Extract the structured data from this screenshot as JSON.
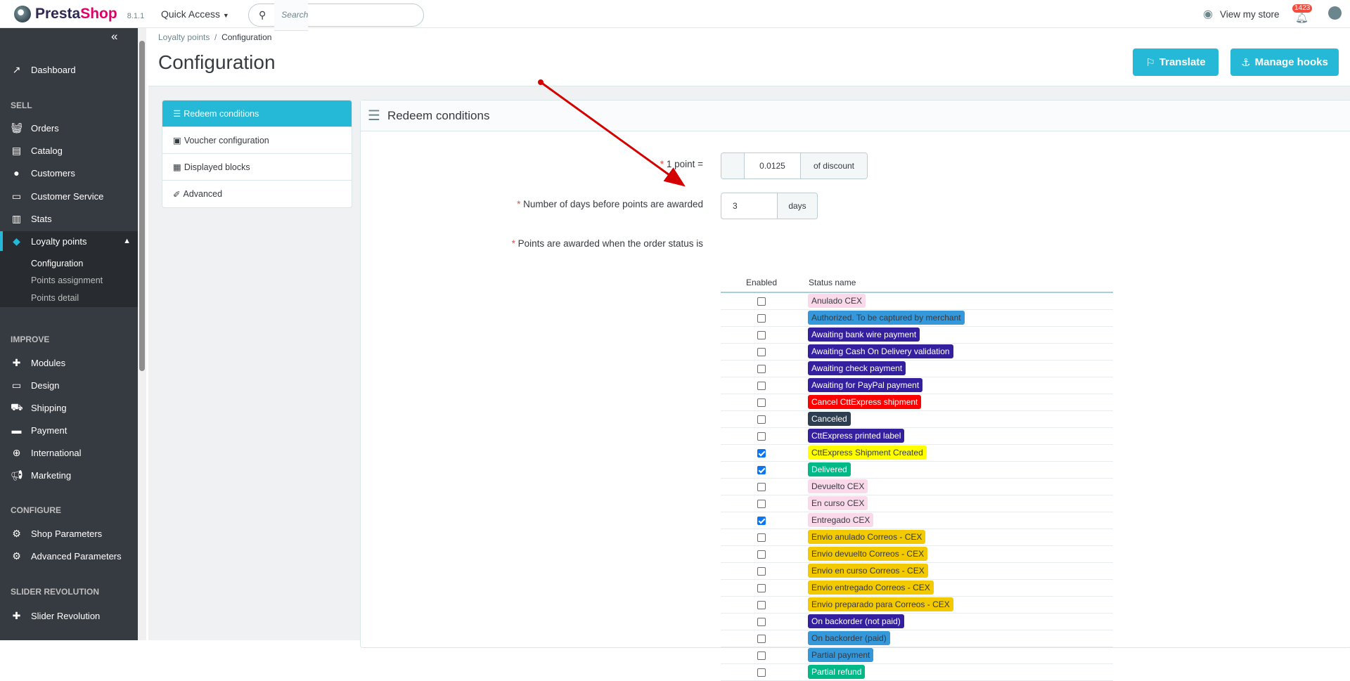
{
  "header": {
    "brand_a": "Presta",
    "brand_b": "Shop",
    "version": "8.1.1",
    "quick_access": "Quick Access",
    "search_placeholder": "Search",
    "view_store": "View my store",
    "notifications": "1423"
  },
  "sidebar": {
    "dashboard": "Dashboard",
    "sell": "SELL",
    "orders": "Orders",
    "catalog": "Catalog",
    "customers": "Customers",
    "customer_service": "Customer Service",
    "stats": "Stats",
    "loyalty": "Loyalty points",
    "sub": [
      "Configuration",
      "Points assignment",
      "Points detail"
    ],
    "improve": "IMPROVE",
    "modules": "Modules",
    "design": "Design",
    "shipping": "Shipping",
    "payment": "Payment",
    "international": "International",
    "marketing": "Marketing",
    "configure": "CONFIGURE",
    "shop_params": "Shop Parameters",
    "adv_params": "Advanced Parameters",
    "slider_sect": "SLIDER REVOLUTION",
    "slider": "Slider Revolution"
  },
  "breadcrumb": {
    "parent": "Loyalty points",
    "current": "Configuration"
  },
  "page_title": "Configuration",
  "toolbar": {
    "translate": "Translate",
    "manage_hooks": "Manage hooks"
  },
  "tabs": [
    "Redeem conditions",
    "Voucher configuration",
    "Displayed blocks",
    "Advanced"
  ],
  "panel": {
    "title": "Redeem conditions",
    "point_label": "1 point =",
    "point_value": "0.0125",
    "point_suffix": "of discount",
    "days_label": "Number of days before points are awarded",
    "days_value": "3",
    "days_suffix": "days",
    "status_label": "Points are awarded when the order status is",
    "col_enabled": "Enabled",
    "col_status": "Status name"
  },
  "statuses": [
    {
      "name": "Anulado CEX",
      "enabled": false,
      "bg": "#f9d9ea",
      "fg": "#363a41"
    },
    {
      "name": "Authorized. To be captured by merchant",
      "enabled": false,
      "bg": "#3498db",
      "fg": "#363a41"
    },
    {
      "name": "Awaiting bank wire payment",
      "enabled": false,
      "bg": "#34209e",
      "fg": "#ffffff"
    },
    {
      "name": "Awaiting Cash On Delivery validation",
      "enabled": false,
      "bg": "#34209e",
      "fg": "#ffffff"
    },
    {
      "name": "Awaiting check payment",
      "enabled": false,
      "bg": "#34209e",
      "fg": "#ffffff"
    },
    {
      "name": "Awaiting for PayPal payment",
      "enabled": false,
      "bg": "#34209e",
      "fg": "#ffffff"
    },
    {
      "name": "Cancel CttExpress shipment",
      "enabled": false,
      "bg": "#ff0000",
      "fg": "#ffffff"
    },
    {
      "name": "Canceled",
      "enabled": false,
      "bg": "#2c3e50",
      "fg": "#ffffff"
    },
    {
      "name": "CttExpress printed label",
      "enabled": false,
      "bg": "#34209e",
      "fg": "#ffffff"
    },
    {
      "name": "CttExpress Shipment Created",
      "enabled": true,
      "bg": "#ffff00",
      "fg": "#363a41"
    },
    {
      "name": "Delivered",
      "enabled": true,
      "bg": "#01b887",
      "fg": "#ffffff"
    },
    {
      "name": "Devuelto CEX",
      "enabled": false,
      "bg": "#f9d9ea",
      "fg": "#363a41"
    },
    {
      "name": "En curso CEX",
      "enabled": false,
      "bg": "#f9d9ea",
      "fg": "#363a41"
    },
    {
      "name": "Entregado CEX",
      "enabled": true,
      "bg": "#f9d9ea",
      "fg": "#363a41"
    },
    {
      "name": "Envio anulado Correos - CEX",
      "enabled": false,
      "bg": "#f3c900",
      "fg": "#363a41"
    },
    {
      "name": "Envio devuelto Correos - CEX",
      "enabled": false,
      "bg": "#f3c900",
      "fg": "#363a41"
    },
    {
      "name": "Envio en curso Correos - CEX",
      "enabled": false,
      "bg": "#f3c900",
      "fg": "#363a41"
    },
    {
      "name": "Envio entregado Correos - CEX",
      "enabled": false,
      "bg": "#f3c900",
      "fg": "#363a41"
    },
    {
      "name": "Envio preparado para Correos - CEX",
      "enabled": false,
      "bg": "#f3c900",
      "fg": "#363a41"
    },
    {
      "name": "On backorder (not paid)",
      "enabled": false,
      "bg": "#34209e",
      "fg": "#ffffff"
    },
    {
      "name": "On backorder (paid)",
      "enabled": false,
      "bg": "#3498db",
      "fg": "#363a41"
    },
    {
      "name": "Partial payment",
      "enabled": false,
      "bg": "#3498db",
      "fg": "#363a41"
    },
    {
      "name": "Partial refund",
      "enabled": false,
      "bg": "#01b887",
      "fg": "#ffffff"
    }
  ],
  "colors": {
    "accent": "#25b9d7",
    "sidebar": "#363a41",
    "annotation_arrow": "#d40000"
  }
}
